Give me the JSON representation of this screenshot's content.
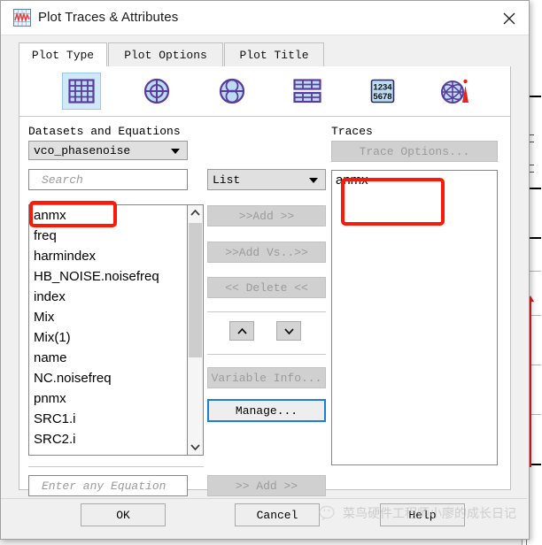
{
  "window": {
    "title": "Plot Traces & Attributes",
    "app_icon": "plot-waveform-icon",
    "close_icon": "close-icon"
  },
  "tabs": [
    {
      "label": "Plot Type",
      "active": true
    },
    {
      "label": "Plot Options",
      "active": false
    },
    {
      "label": "Plot Title",
      "active": false
    }
  ],
  "toolbar": {
    "items": [
      {
        "icon": "rectangular-plot-icon",
        "selected": true
      },
      {
        "icon": "polar-plot-icon",
        "selected": false
      },
      {
        "icon": "smith-chart-icon",
        "selected": false
      },
      {
        "icon": "stacked-table-icon",
        "selected": false
      },
      {
        "icon": "list-numbers-icon",
        "selected": false
      },
      {
        "icon": "antenna-plot-icon",
        "selected": false
      }
    ]
  },
  "datasets_panel": {
    "label": "Datasets and Equations",
    "dataset_select": {
      "value": "vco_phasenoise",
      "caret_icon": "chevron-down-icon"
    },
    "search": {
      "placeholder": "Search",
      "value": ""
    },
    "items": [
      "anmx",
      "freq",
      "harmindex",
      "HB_NOISE.noisefreq",
      "index",
      "Mix",
      "Mix(1)",
      "name",
      "NC.noisefreq",
      "pnmx",
      "SRC1.i",
      "SRC2.i"
    ],
    "selected_item": "anmx",
    "scrollbar": {
      "up_icon": "chevron-up-icon",
      "down_icon": "chevron-down-icon"
    },
    "equation": {
      "placeholder": "Enter any Equation",
      "value": ""
    },
    "equation_add_label": ">> Add >>"
  },
  "middle_column": {
    "view_select": {
      "value": "List",
      "caret_icon": "chevron-down-icon"
    },
    "add_label": ">>Add >>",
    "add_vs_label": ">>Add Vs..>>",
    "delete_label": "<< Delete <<",
    "move_up_icon": "chevron-up-icon",
    "move_down_icon": "chevron-down-icon",
    "variable_info_label": "Variable Info...",
    "manage_label": "Manage..."
  },
  "traces_panel": {
    "label": "Traces",
    "trace_options_label": "Trace Options...",
    "items": [
      "anmx"
    ]
  },
  "footer": {
    "ok_label": "OK",
    "cancel_label": "Cancel",
    "help_label": "Help"
  },
  "watermark": {
    "text": "菜鸟硬件工程师小廖的成长日记",
    "icon": "wechat-logo-icon"
  },
  "colors": {
    "annotation": "#fb1a08",
    "focus_border": "#1b7fd4",
    "selected_tool_bg": "#cfe8fa",
    "icon_stroke": "#5b3c9e"
  }
}
